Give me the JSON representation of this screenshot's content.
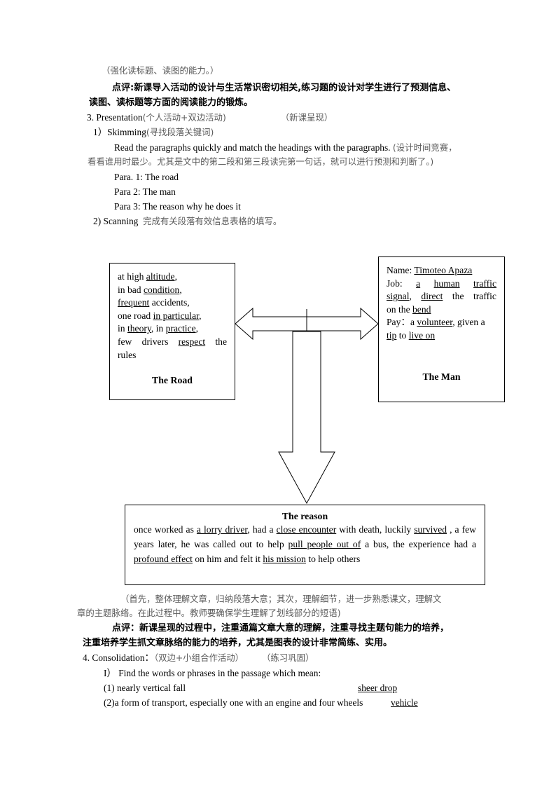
{
  "document": {
    "top_notes": [
      {
        "id": "note-ability",
        "text": "（强化读标题、读图的能力。）",
        "style": "cn"
      }
    ],
    "comment_1": {
      "label": "点评:",
      "line1": "点评:新课导入活动的设计与生活常识密切相关,练习题的设计对学生进行了预测信息、",
      "line2": "读图、读标题等方面的阅读能力的锻炼。"
    },
    "section_presentation": {
      "number": "3.",
      "title_en": "Presentation",
      "title_cn": "(个人活动+双边活动)",
      "tag_cn": "（新课呈现）"
    },
    "skimming": {
      "marker": "1）",
      "title_en": "Skimming",
      "title_cn": "(寻找段落关键词)",
      "instruction_en": "Read the paragraphs quickly and match the headings with the paragraphs.",
      "instruction_cn_part1": "(设计时间竞赛，",
      "instruction_cn_part2": "看看谁用时最少。尤其是文中的第二段和第三段读完第一句话，就可以进行预测和判断了。)",
      "paras": [
        "Para. 1: The road",
        "Para 2: The man",
        "Para 3: The reason why he does it"
      ]
    },
    "scanning": {
      "marker": "2)",
      "title_en": "Scanning",
      "title_cn": "完成有关段落有效信息表格的填写。"
    },
    "diagram": {
      "box_road": {
        "title": "The Road",
        "lines": [
          [
            {
              "t": "at high ",
              "u": false
            },
            {
              "t": "altitude",
              "u": true
            },
            {
              "t": ",",
              "u": false
            }
          ],
          [
            {
              "t": "in bad ",
              "u": false
            },
            {
              "t": "condition",
              "u": true
            },
            {
              "t": ",",
              "u": false
            }
          ],
          [
            {
              "t": "frequent",
              "u": true
            },
            {
              "t": " accidents,",
              "u": false
            }
          ],
          [
            {
              "t": "one road ",
              "u": false
            },
            {
              "t": "in particular",
              "u": true
            },
            {
              "t": ",",
              "u": false
            }
          ],
          [
            {
              "t": "in ",
              "u": false
            },
            {
              "t": "theory",
              "u": true
            },
            {
              "t": ", in ",
              "u": false
            },
            {
              "t": "practice",
              "u": true
            },
            {
              "t": ",",
              "u": false
            }
          ],
          [
            {
              "t": "few",
              "u": false
            },
            {
              "t": "drivers",
              "u": false
            },
            {
              "t": "respect",
              "u": true
            },
            {
              "t": "the",
              "u": false
            }
          ],
          [
            {
              "t": "rules",
              "u": false
            }
          ]
        ]
      },
      "box_man": {
        "title": "The Man",
        "lines": [
          [
            {
              "t": "Name: ",
              "u": false
            },
            {
              "t": "Timoteo Apaza",
              "u": true
            }
          ],
          [
            {
              "t": "Job: ",
              "u": false
            },
            {
              "t": "a",
              "u": true
            },
            {
              "t": "human",
              "u": true
            },
            {
              "t": "traffic",
              "u": true
            }
          ],
          [
            {
              "t": "signal",
              "u": true
            },
            {
              "t": ", ",
              "u": false
            },
            {
              "t": "direct",
              "u": true
            },
            {
              "t": " the traffic",
              "u": false
            }
          ],
          [
            {
              "t": "on the ",
              "u": false
            },
            {
              "t": "bend",
              "u": true
            }
          ],
          [
            {
              "t": "Pay：a ",
              "u": false
            },
            {
              "t": "volunteer",
              "u": true
            },
            {
              "t": ", given a",
              "u": false
            }
          ],
          [
            {
              "t": "tip",
              "u": true
            },
            {
              "t": " to ",
              "u": false
            },
            {
              "t": "live on",
              "u": true
            }
          ]
        ]
      },
      "box_reason": {
        "title": "The reason",
        "segments": [
          {
            "t": "once worked as ",
            "u": false
          },
          {
            "t": "a lorry driver",
            "u": true
          },
          {
            "t": ", had a ",
            "u": false
          },
          {
            "t": "close encounter",
            "u": true
          },
          {
            "t": " with death, luckily ",
            "u": false
          },
          {
            "t": "survived",
            "u": true
          },
          {
            "t": " , a few years later, he was called out to help ",
            "u": false
          },
          {
            "t": "pull people out of",
            "u": true
          },
          {
            "t": " a bus, the experience had a ",
            "u": false
          },
          {
            "t": "profound effect",
            "u": true
          },
          {
            "t": " on him and felt it ",
            "u": false
          },
          {
            "t": "his mission",
            "u": true
          },
          {
            "t": " to help others",
            "u": false
          }
        ]
      },
      "arrows": {
        "horizontal_double": "double-headed-horizontal-arrow",
        "vertical_down": "block-down-arrow"
      }
    },
    "note_after_diagram": {
      "line1": "（首先，整体理解文章，归纳段落大意；其次，理解细节，进一步熟悉课文，理解文",
      "line2": "章的主题脉络。在此过程中。教师要确保学生理解了划线部分的短语)"
    },
    "comment_2": {
      "line1": "点评：新课呈现的过程中，注重通篇文章大意的理解，注重寻找主题句能力的培养，",
      "line2": "注重培养学生抓文章脉络的能力的培养，尤其是图表的设计非常简练、实用。"
    },
    "section_consolidation": {
      "number": "4.",
      "title_en": "Consolidation：",
      "title_cn": "（双边+小组合作活动）",
      "tag_cn": "（练习巩固）"
    },
    "exercise": {
      "marker": "I）",
      "prompt": "Find the words or phrases in the passage which mean:",
      "items": [
        {
          "num": "(1)",
          "clue": "nearly vertical fall",
          "answer": "sheer drop"
        },
        {
          "num": "(2)",
          "clue": "a form of transport, especially one with an engine and four wheels",
          "answer": "vehicle"
        }
      ]
    }
  }
}
